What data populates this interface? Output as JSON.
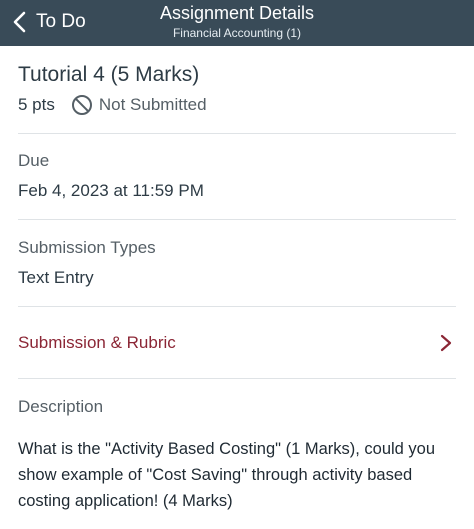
{
  "nav": {
    "back_label": "To Do",
    "title": "Assignment Details",
    "subtitle": "Financial Accounting (1)"
  },
  "assignment": {
    "title": "Tutorial 4 (5 Marks)",
    "points": "5 pts",
    "status": "Not Submitted"
  },
  "due": {
    "label": "Due",
    "value": "Feb 4, 2023 at 11:59 PM"
  },
  "submission_types": {
    "label": "Submission Types",
    "value": "Text Entry"
  },
  "submission_rubric": {
    "label": "Submission & Rubric"
  },
  "description": {
    "label": "Description",
    "text": "What is the \"Activity Based Costing\" (1 Marks), could you show example of \"Cost Saving\" through activity based costing application! (4 Marks)"
  },
  "colors": {
    "navbar": "#394b58",
    "link": "#8b2635",
    "text": "#2d3b45",
    "muted": "#555f66"
  }
}
